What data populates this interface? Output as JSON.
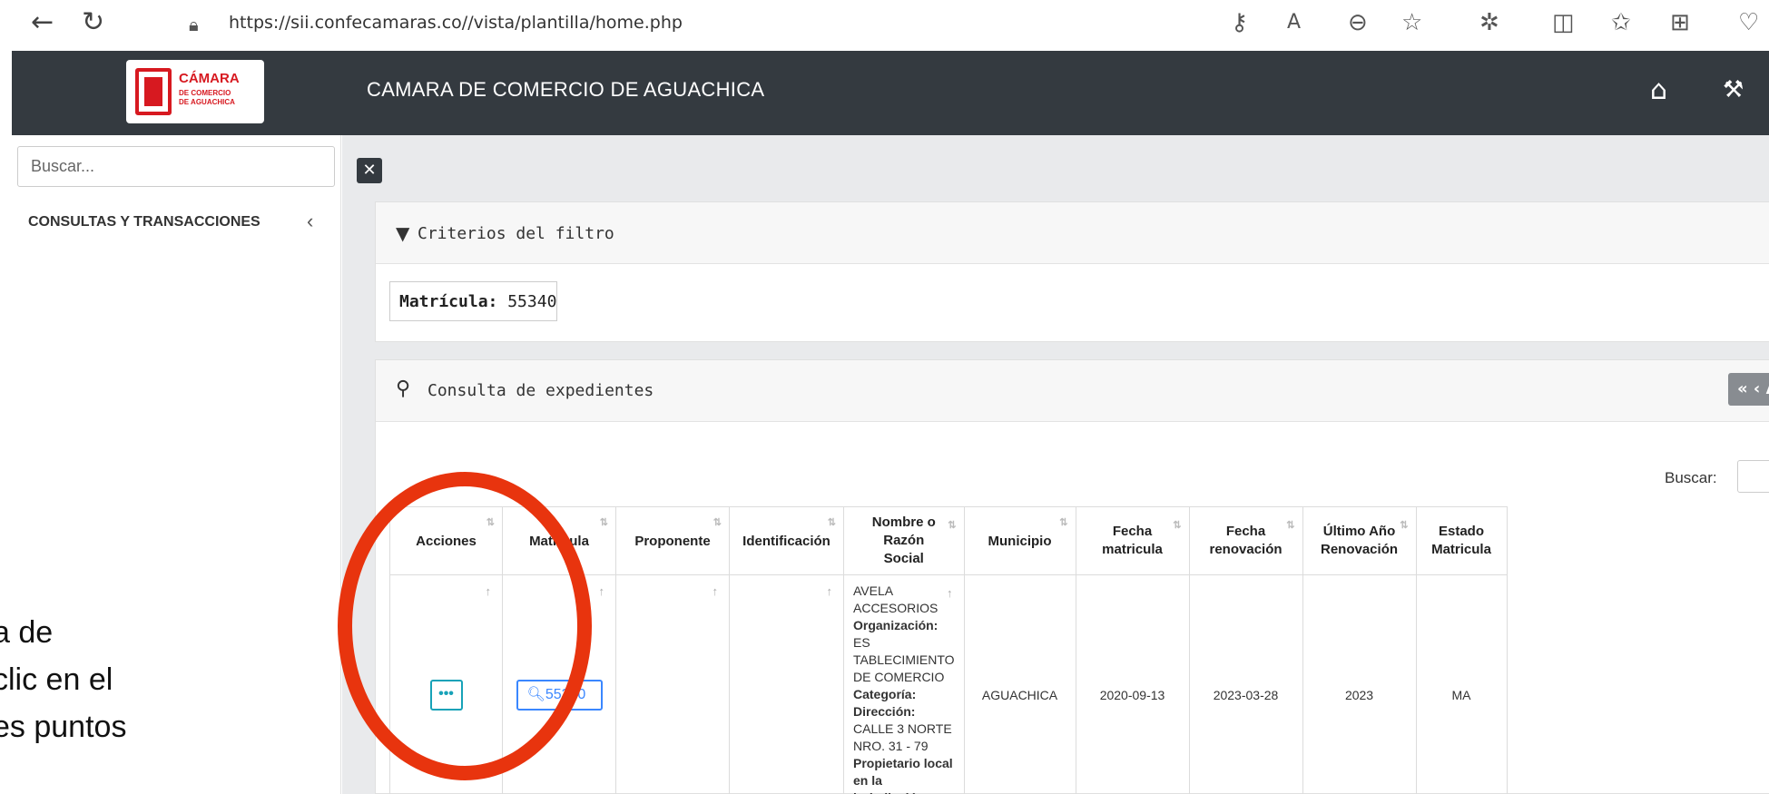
{
  "browser": {
    "url": "https://sii.confecamaras.co//vista/plantilla/home.php",
    "icons": [
      "back-icon",
      "refresh-icon",
      "lock-icon",
      "key-icon",
      "read-aloud-icon",
      "zoom-out-icon",
      "favorite-icon",
      "extensions-icon",
      "split-screen-icon",
      "favorites-list-icon",
      "collections-icon",
      "health-icon"
    ]
  },
  "header": {
    "logo": {
      "main": "CÁMARA",
      "sub1": "DE COMERCIO",
      "sub2": "DE AGUACHICA"
    },
    "title": "CAMARA DE COMERCIO DE AGUACHICA"
  },
  "sidebar": {
    "search_placeholder": "Buscar...",
    "menu_label": "CONSULTAS Y TRANSACCIONES"
  },
  "filter": {
    "title": "Criterios del filtro",
    "matricula_label": "Matrícula:",
    "matricula_value": "55340"
  },
  "consulta": {
    "title": "Consulta de expedientes",
    "pager_label": "« ‹ A",
    "buscar_label": "Buscar:",
    "columns": [
      "Acciones",
      "Matricula",
      "Proponente",
      "Identificación",
      "Nombre o Razón Social",
      "Municipio",
      "Fecha matricula",
      "Fecha renovación",
      "Último Año Renovación",
      "Estado Matricula"
    ],
    "row": {
      "actions": "•••",
      "matricula": "55340",
      "name_line1": "AVELA",
      "name_line2": "ACCESORIOS",
      "org_label": "Organización:",
      "org_value": "ES TABLECIMIENTO DE COMERCIO",
      "categoria_label": "Categoría:",
      "direccion_label": "Dirección:",
      "direccion_value": "CALLE 3 NORTE NRO. 31 - 79",
      "propietario_label": "Propietario local en la jurisdicción",
      "municipio": "AGUACHICA",
      "fecha_matricula": "2020-09-13",
      "fecha_renovacion": "2023-03-28",
      "ultimo_anio": "2023",
      "estado": "MA"
    }
  },
  "annotation": {
    "line1": "a de",
    "line2": "clic en el",
    "line3": "es puntos",
    "color": "#e8340e"
  }
}
